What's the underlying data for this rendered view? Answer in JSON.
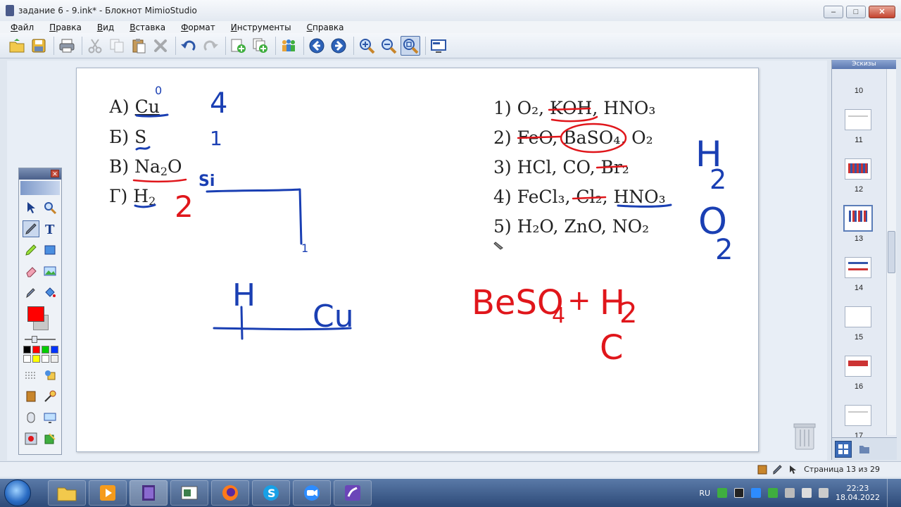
{
  "window": {
    "title": "задание 6 - 9.ink* - Блокнот MimioStudio",
    "minimize": "–",
    "maximize": "□",
    "close": "✕"
  },
  "menu": [
    "Файл",
    "Правка",
    "Вид",
    "Вставка",
    "Формат",
    "Инструменты",
    "Справка"
  ],
  "toolbar": {
    "items": [
      "open-icon",
      "save-icon",
      "print-icon",
      "cut-icon",
      "copy-icon",
      "paste-icon",
      "delete-icon",
      "undo-icon",
      "redo-icon",
      "new-page-icon",
      "duplicate-page-icon",
      "collaborate-icon",
      "previous-page-icon",
      "next-page-icon",
      "zoom-in-icon",
      "zoom-out-icon",
      "fit-page-icon",
      "screen-icon"
    ]
  },
  "page": {
    "left_column": [
      {
        "label": "А)",
        "formula": "Cu"
      },
      {
        "label": "Б)",
        "formula": "S"
      },
      {
        "label": "В)",
        "formula": "Na",
        "sub": "2",
        "formula_end": "O"
      },
      {
        "label": "Г)",
        "formula": "H",
        "sub": "2"
      }
    ],
    "right_column": [
      "1) O₂, KOH, HNO₃",
      "2) FeO, BaSO₄, O₂",
      "3) HCl, CO, Br₂",
      "4) FeCl₃, Cl₂, HNO₃",
      "5) H₂O, ZnO, NO₂"
    ],
    "handwriting": {
      "blue": [
        "0",
        "4",
        "1",
        "Si",
        "1",
        "H",
        "Cu",
        "H",
        "2",
        "O",
        "2"
      ],
      "red": [
        "2",
        "BeSO",
        "4",
        "+",
        "H",
        "2",
        "C"
      ]
    }
  },
  "thumbnails": {
    "header": "Эскизы",
    "pages": [
      "10",
      "11",
      "12",
      "13",
      "14",
      "15",
      "16",
      "17"
    ],
    "selected": "13"
  },
  "status": {
    "page_label": "Страница 13 из 29"
  },
  "taskbar": {
    "language": "RU",
    "time": "22:23",
    "date": "18.04.2022",
    "apps": [
      "explorer-icon",
      "media-player-icon",
      "mimio-notebook-icon",
      "presentation-icon",
      "firefox-icon",
      "skype-icon",
      "zoom-icon",
      "mimio-studio-icon"
    ]
  },
  "colors": {
    "pen_blue": "#1a3fb3",
    "pen_red": "#e0161b",
    "selected_color": "#ff0000",
    "page_bg": "#ffffff"
  }
}
